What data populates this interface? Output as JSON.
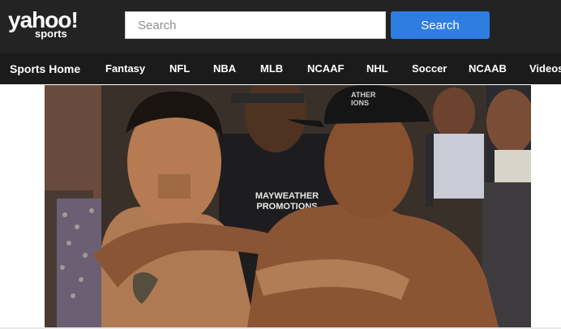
{
  "logo": {
    "main": "yahoo!",
    "sub": "sports"
  },
  "search": {
    "placeholder": "Search",
    "value": "",
    "button_label": "Search"
  },
  "nav": {
    "items": [
      "Sports Home",
      "Fantasy",
      "NFL",
      "NBA",
      "MLB",
      "NCAAF",
      "NHL",
      "Soccer",
      "NCAAB",
      "Videos"
    ]
  },
  "photo": {
    "hat_text": "ATHER\nIONS",
    "shirt_text_line1": "MAYWEATHER",
    "shirt_text_line2": "PROMOTIONS"
  },
  "colors": {
    "topbar": "#232323",
    "navbar": "#1b1b1b",
    "search_button": "#2f7de1"
  }
}
